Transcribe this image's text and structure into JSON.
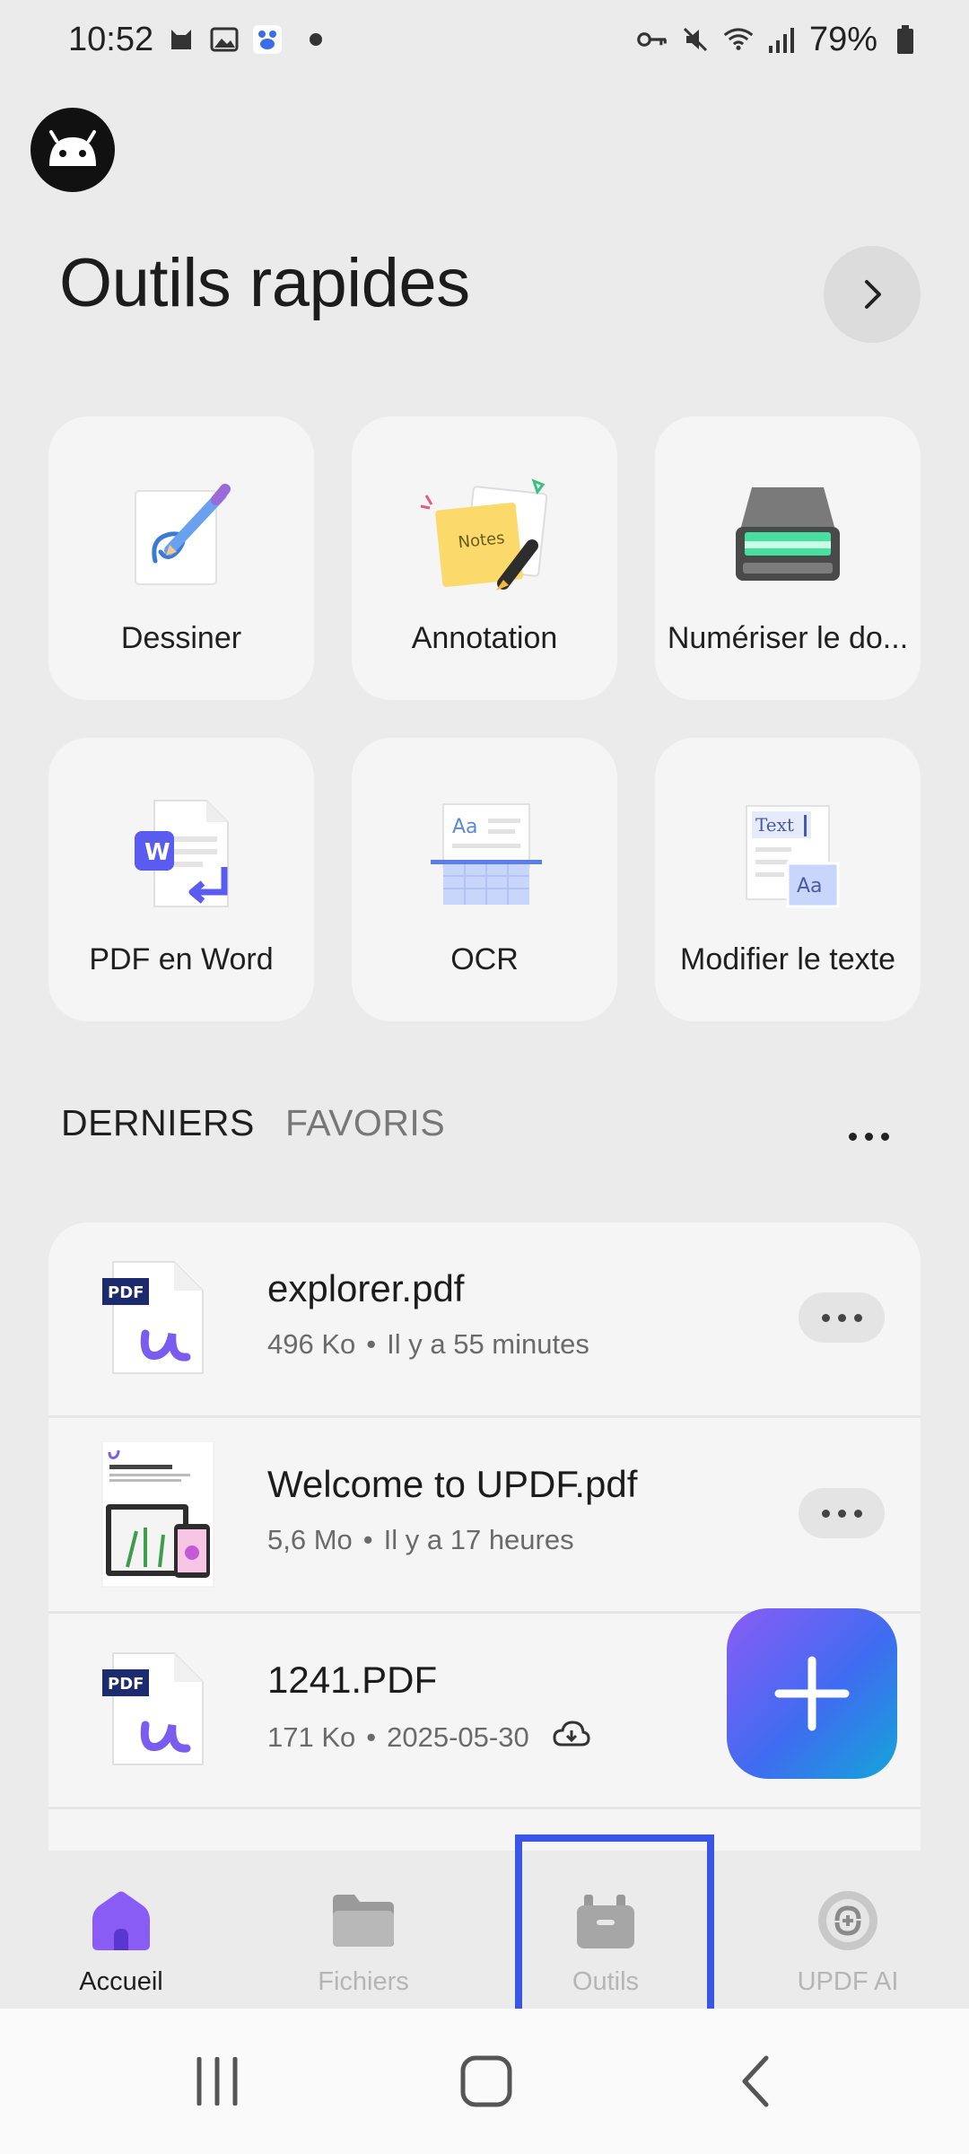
{
  "status_bar": {
    "time": "10:52",
    "battery": "79%",
    "icons": [
      "cat-icon",
      "image-icon",
      "paw-app-icon",
      "dot",
      "key-icon",
      "mute-icon",
      "wifi-icon",
      "signal-icon",
      "battery-icon"
    ]
  },
  "header": {
    "title": "Outils rapides"
  },
  "tools": [
    {
      "label": "Dessiner",
      "icon": "draw-icon"
    },
    {
      "label": "Annotation",
      "icon": "notes-icon"
    },
    {
      "label": "Numériser le do...",
      "icon": "scanner-icon"
    },
    {
      "label": "PDF en Word",
      "icon": "pdf-to-word-icon"
    },
    {
      "label": "OCR",
      "icon": "ocr-icon"
    },
    {
      "label": "Modifier le texte",
      "icon": "edit-text-icon"
    }
  ],
  "tabs": {
    "recent": "DERNIERS",
    "favorites": "FAVORIS"
  },
  "files": [
    {
      "name": "explorer.pdf",
      "size": "496 Ko",
      "sep": "•",
      "time": "Il y a 55 minutes",
      "thumb": "pdf-icon"
    },
    {
      "name": "Welcome to UPDF.pdf",
      "size": "5,6 Mo",
      "sep": "•",
      "time": "Il y a 17 heures",
      "thumb": "document-thumbnail"
    },
    {
      "name": "1241.PDF",
      "size": "171 Ko",
      "sep": "•",
      "time": "2025-05-30",
      "thumb": "pdf-icon",
      "cloud": true
    }
  ],
  "pdf_badge": "PDF",
  "bottom_nav": {
    "home": "Accueil",
    "files": "Fichiers",
    "tools": "Outils",
    "ai": "UPDF AI"
  },
  "colors": {
    "accent": "#7c5cf0",
    "highlight": "#3b55e6",
    "background": "#ebebeb",
    "card": "#f5f5f5"
  }
}
